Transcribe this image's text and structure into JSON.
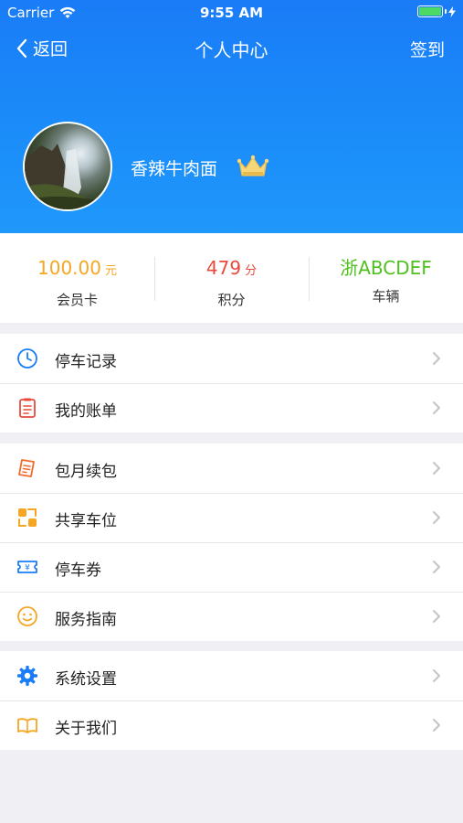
{
  "status": {
    "carrier": "Carrier",
    "time": "9:55 AM"
  },
  "nav": {
    "back_label": "返回",
    "title": "个人中心",
    "action_label": "签到"
  },
  "profile": {
    "username": "香辣牛肉面"
  },
  "stats": [
    {
      "value": "100.00",
      "unit": "元",
      "label": "会员卡",
      "color": "#f5a623"
    },
    {
      "value": "479",
      "unit": "分",
      "label": "积分",
      "color": "#e84a3c"
    },
    {
      "value": "浙ABCDEF",
      "unit": "",
      "label": "车辆",
      "color": "#4fc01e"
    }
  ],
  "menu": {
    "group1": [
      {
        "label": "停车记录",
        "icon": "clock-icon"
      },
      {
        "label": "我的账单",
        "icon": "bill-icon"
      }
    ],
    "group2": [
      {
        "label": "包月续包",
        "icon": "monthly-package-icon"
      },
      {
        "label": "共享车位",
        "icon": "shared-parking-icon"
      },
      {
        "label": "停车券",
        "icon": "coupon-icon"
      },
      {
        "label": "服务指南",
        "icon": "smile-icon"
      }
    ],
    "group3": [
      {
        "label": "系统设置",
        "icon": "gear-icon"
      },
      {
        "label": "关于我们",
        "icon": "book-icon"
      }
    ]
  },
  "colors": {
    "header": "#1a85f8",
    "accent_orange": "#f5a623",
    "accent_red": "#e84a3c",
    "accent_green": "#4fc01e",
    "icon_blue": "#1a7cf7"
  }
}
